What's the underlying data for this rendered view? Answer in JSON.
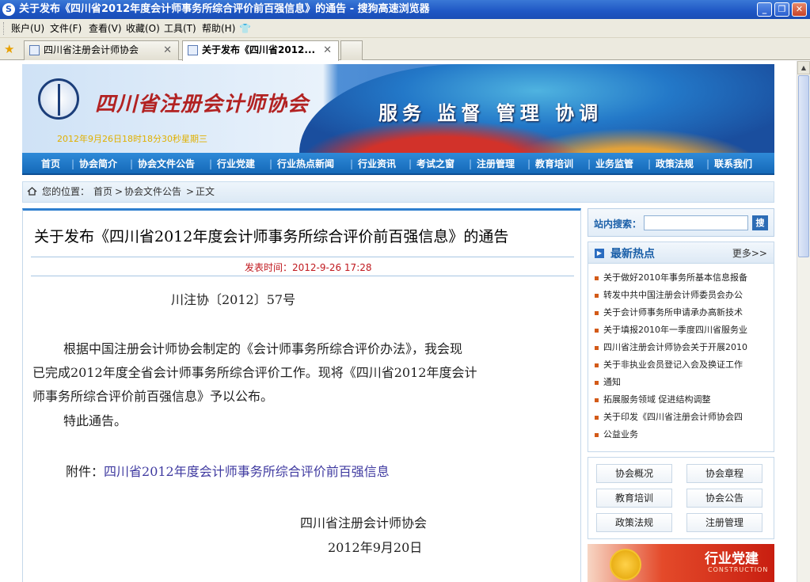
{
  "window": {
    "title": "关于发布《四川省2012年度会计师事务所综合评价前百强信息》的通告 - 搜狗高速浏览器",
    "minimize": "_",
    "restore": "❐",
    "close": "✕"
  },
  "menu": [
    "账户(U)",
    "文件(F)",
    "查看(V)",
    "收藏(O)",
    "工具(T)",
    "帮助(H)"
  ],
  "tabs": [
    {
      "label": "四川省注册会计师协会",
      "active": false
    },
    {
      "label": "关于发布《四川省2012...",
      "active": true
    }
  ],
  "header": {
    "site_name": "四川省注册会计师协会",
    "datetime": "2012年9月26日18时18分30秒星期三",
    "slogan": "服务 监督 管理 协调"
  },
  "nav": [
    "首页",
    "协会简介",
    "协会文件公告",
    "行业党建",
    "行业热点新闻",
    "行业资讯",
    "考试之窗",
    "注册管理",
    "教育培训",
    "业务监管",
    "政策法规",
    "联系我们"
  ],
  "breadcrumb": {
    "prefix": "您的位置：",
    "items": [
      "首页",
      "协会文件公告",
      "正文"
    ],
    "sep": ">"
  },
  "article": {
    "title": "关于发布《四川省2012年度会计师事务所综合评价前百强信息》的通告",
    "pubtime": "发表时间：2012-9-26 17:28",
    "doc_no": "川注协〔2012〕57号",
    "para1_line1": "根据中国注册会计师协会制定的《会计师事务所综合评价办法》，我会现",
    "para1_line2": "已完成2012年度全省会计师事务所综合评价工作。现将《四川省2012年度会计",
    "para1_line3": "师事务所综合评价前百强信息》予以公布。",
    "para2": "特此通告。",
    "attach_label": "附件：",
    "attach_link": "四川省2012年度会计师事务所综合评价前百强信息",
    "signer": "四川省注册会计师协会",
    "date": "2012年9月20日"
  },
  "sidebar": {
    "search_label": "站内搜索：",
    "search_value": "",
    "search_button": "搜",
    "hot_title": "最新热点",
    "hot_more": "更多>>",
    "hot_items": [
      "关于做好2010年事务所基本信息报备",
      "转发中共中国注册会计师委员会办公",
      "关于会计师事务所申请承办高新技术",
      "关于填报2010年一季度四川省服务业",
      "四川省注册会计师协会关于开展2010",
      "关于非执业会员登记入会及换证工作",
      "通知",
      "拓展服务领域 促进结构调整",
      "关于印发《四川省注册会计师协会四",
      "公益业务"
    ],
    "quick_links": [
      "协会概况",
      "协会章程",
      "教育培训",
      "协会公告",
      "政策法规",
      "注册管理"
    ],
    "party_banner_title": "行业党建",
    "party_banner_sub": "CONSTRUCTION"
  },
  "colors": {
    "nav_bg": "#1a72c2",
    "pubtime": "#c0181e",
    "link": "#3f3aa0",
    "accent": "#1a5fa8"
  }
}
